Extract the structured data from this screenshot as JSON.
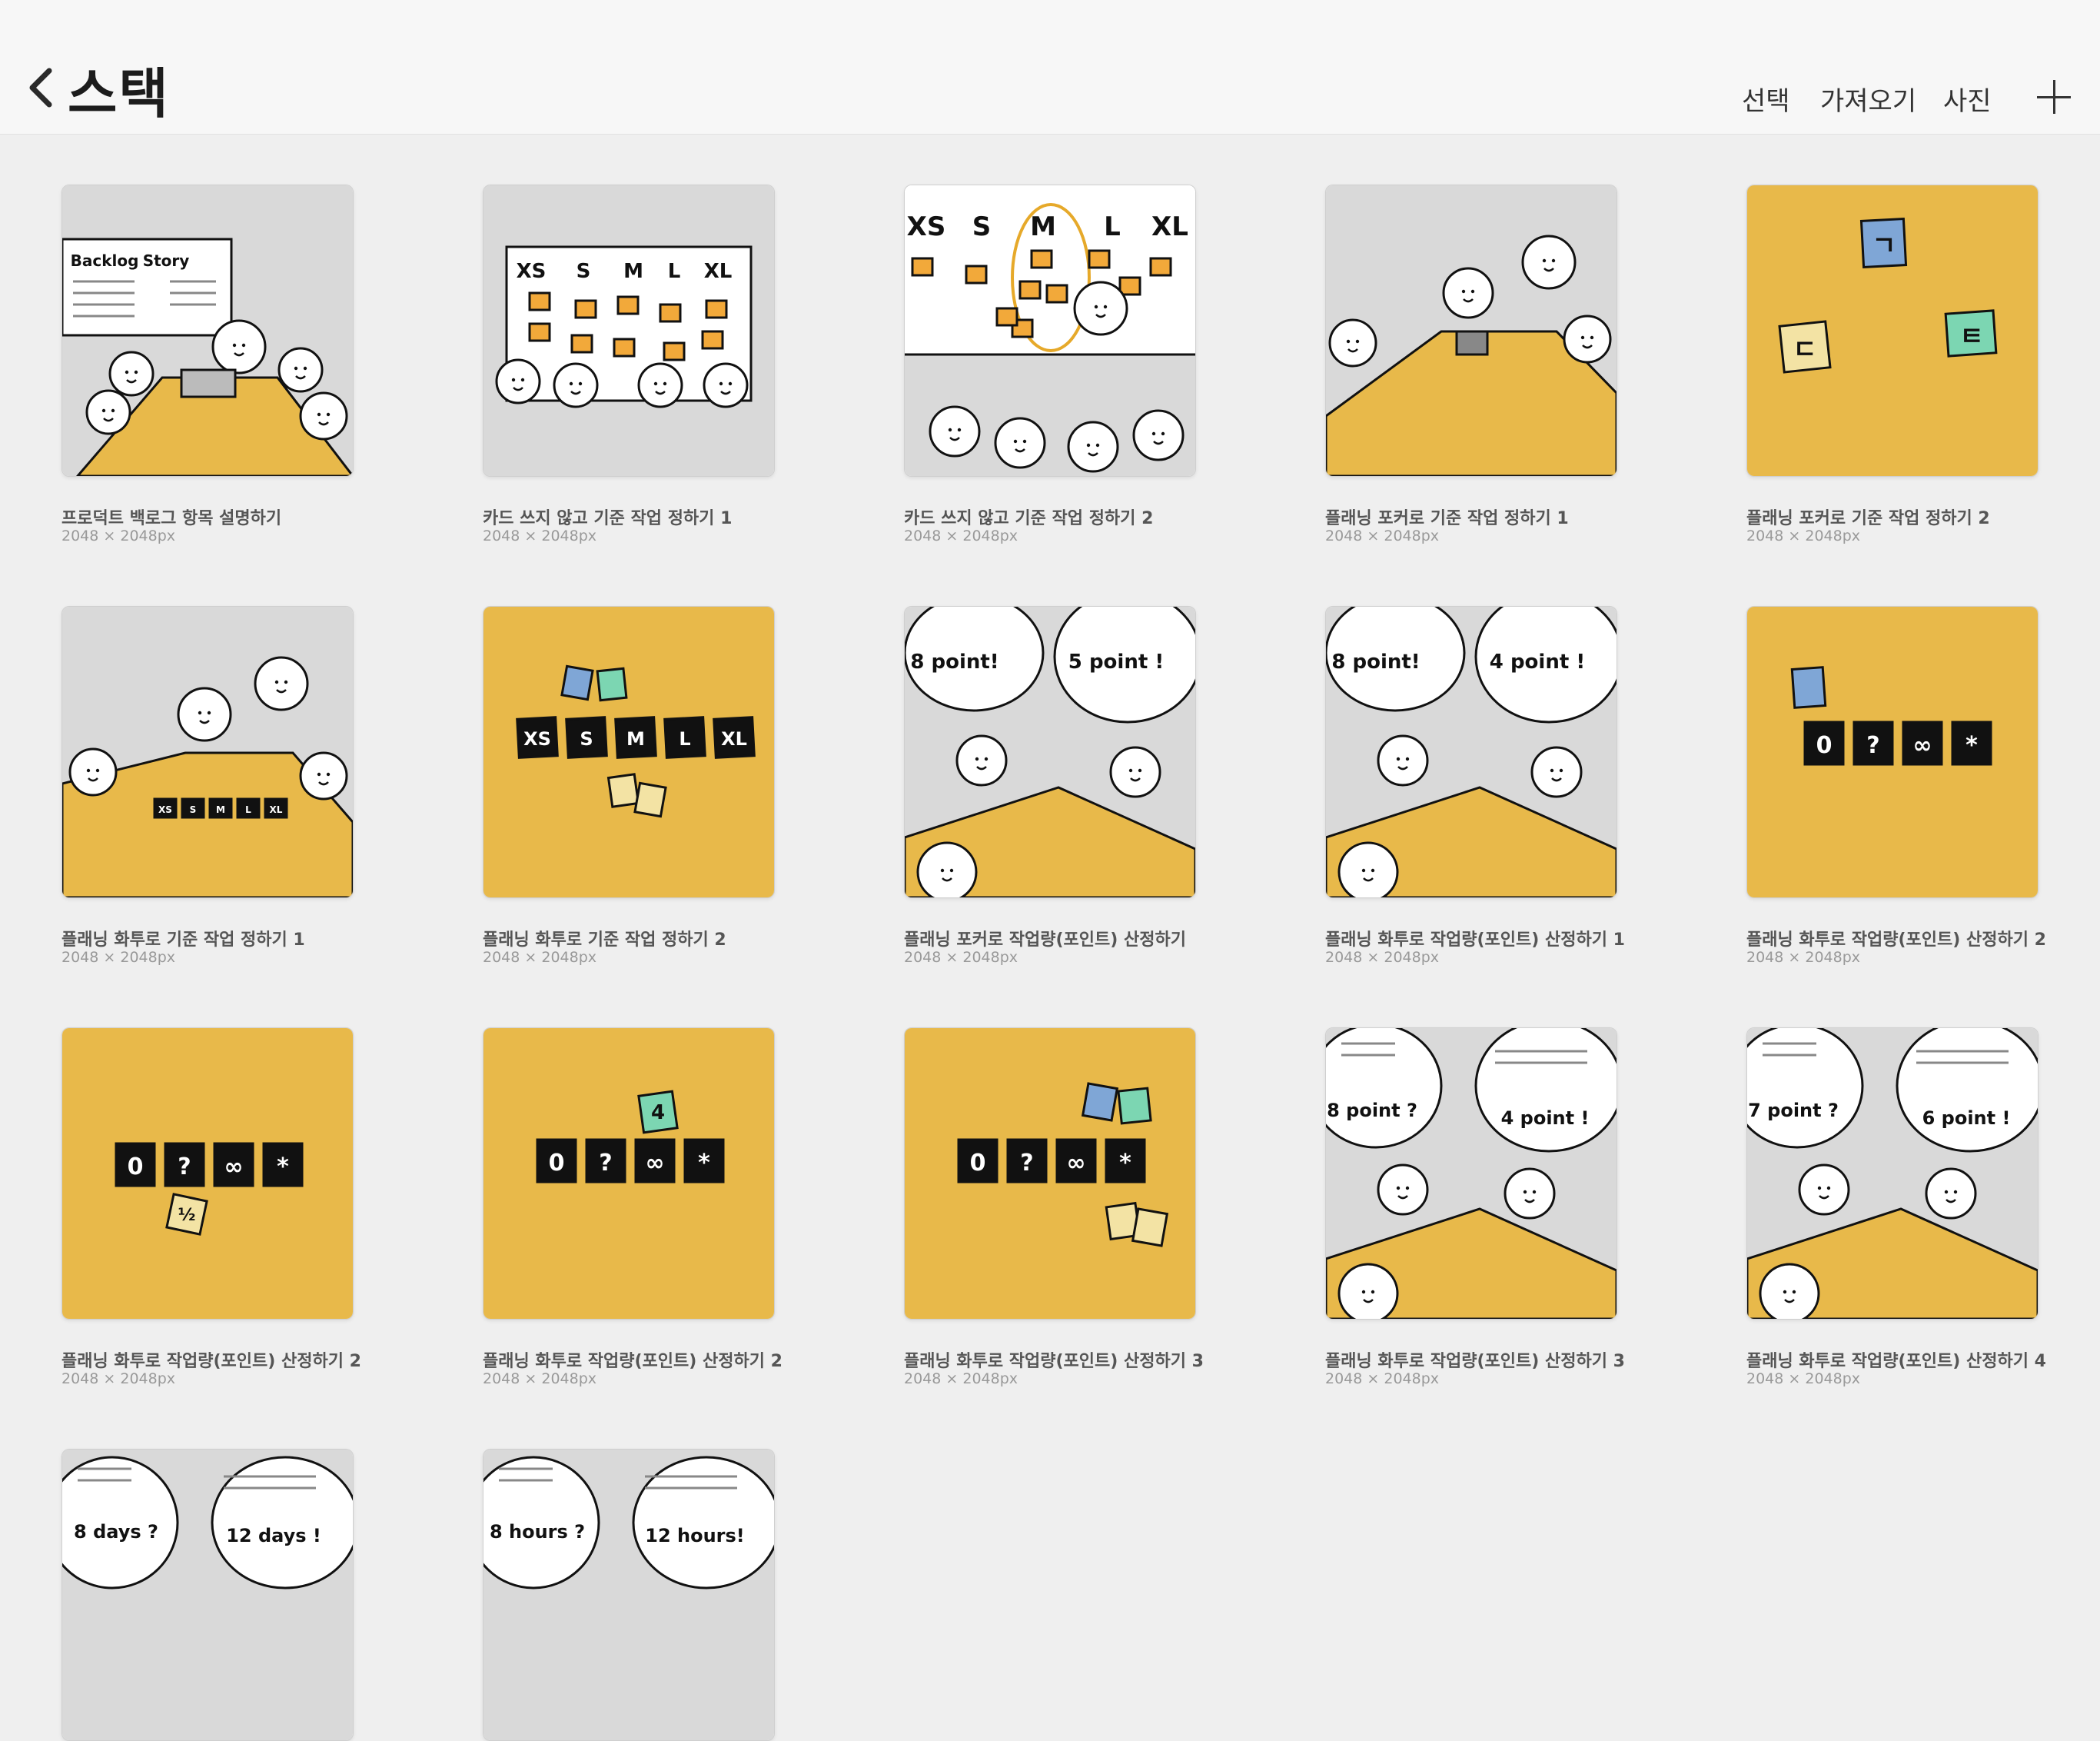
{
  "header": {
    "title": "스택",
    "actions": [
      "선택",
      "가져오기",
      "사진"
    ]
  },
  "items": [
    {
      "name": "프로덕트 백로그 항목 설명하기",
      "size": "2048 × 2048px",
      "art": "backlog",
      "labels": [
        "Backlog",
        "Story"
      ]
    },
    {
      "name": "카드 쓰지 않고 기준 작업 정하기 1",
      "size": "2048 × 2048px",
      "art": "board1",
      "labels": [
        "XS",
        "S",
        "M",
        "L",
        "XL"
      ]
    },
    {
      "name": "카드 쓰지 않고 기준 작업 정하기 2",
      "size": "2048 × 2048px",
      "art": "board2",
      "labels": [
        "XS",
        "S",
        "M",
        "L",
        "XL"
      ]
    },
    {
      "name": "플래닝 포커로 기준 작업 정하기 1",
      "size": "2048 × 2048px",
      "art": "table",
      "labels": []
    },
    {
      "name": "플래닝 포커로 기준 작업 정하기 2",
      "size": "2048 × 2048px",
      "art": "yellowcards",
      "labels": [
        "ㄱ",
        "ㄷ",
        "ㅌ"
      ]
    },
    {
      "name": "플래닝 화투로 기준 작업 정하기 1",
      "size": "2048 × 2048px",
      "art": "table2",
      "labels": [
        "XS",
        "S",
        "M",
        "L",
        "XL"
      ]
    },
    {
      "name": "플래닝 화투로 기준 작업 정하기 2",
      "size": "2048 × 2048px",
      "art": "sizecards",
      "labels": [
        "XS",
        "S",
        "M",
        "L",
        "XL"
      ]
    },
    {
      "name": "플래닝 포커로 작업량(포인트) 산정하기",
      "size": "2048 × 2048px",
      "art": "bubbles",
      "labels": [
        "8 point!",
        "5 point !"
      ]
    },
    {
      "name": "플래닝 화투로 작업량(포인트) 산정하기 1",
      "size": "2048 × 2048px",
      "art": "bubbles",
      "labels": [
        "8 point!",
        "4 point !"
      ]
    },
    {
      "name": "플래닝 화투로 작업량(포인트) 산정하기 2",
      "size": "2048 × 2048px",
      "art": "specialcards",
      "labels": [
        "0",
        "?",
        "∞",
        "*"
      ]
    },
    {
      "name": "플래닝 화투로 작업량(포인트) 산정하기 2",
      "size": "2048 × 2048px",
      "art": "specialcards2",
      "labels": [
        "0",
        "?",
        "∞",
        "*",
        "½"
      ]
    },
    {
      "name": "플래닝 화투로 작업량(포인트) 산정하기 2",
      "size": "2048 × 2048px",
      "art": "specialcards3",
      "labels": [
        "0",
        "?",
        "∞",
        "*",
        "4"
      ]
    },
    {
      "name": "플래닝 화투로 작업량(포인트) 산정하기 3",
      "size": "2048 × 2048px",
      "art": "specialcards4",
      "labels": [
        "0",
        "?",
        "∞",
        "*"
      ]
    },
    {
      "name": "플래닝 화투로 작업량(포인트) 산정하기 3",
      "size": "2048 × 2048px",
      "art": "bubbles2",
      "labels": [
        "8 point ?",
        "4 point !"
      ]
    },
    {
      "name": "플래닝 화투로 작업량(포인트) 산정하기 4",
      "size": "2048 × 2048px",
      "art": "bubbles2",
      "labels": [
        "7 point ?",
        "6 point !"
      ]
    },
    {
      "name": "",
      "size": "",
      "art": "bubbles3",
      "labels": [
        "8 days ?",
        "12 days !"
      ]
    },
    {
      "name": "",
      "size": "",
      "art": "bubbles3",
      "labels": [
        "8 hours ?",
        "12 hours!"
      ]
    }
  ]
}
